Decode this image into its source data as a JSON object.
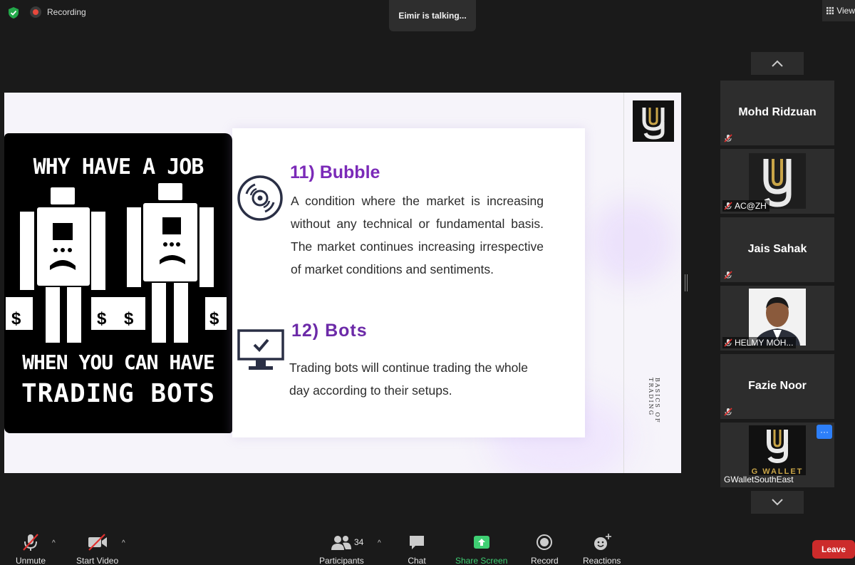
{
  "top_bar": {
    "recording_label": "Recording",
    "talking_label": "Eimir is talking...",
    "view_label": "View"
  },
  "slide": {
    "poster": {
      "line1": "WHY HAVE A JOB",
      "line2": "WHEN YOU CAN HAVE",
      "line3": "TRADING BOTS"
    },
    "item11": {
      "title": "11) Bubble",
      "body": "A condition where the market is increasing without any technical or fundamental basis. The market continues increasing irrespective of market conditions and sentiments."
    },
    "item12": {
      "title": "12) Bots",
      "body": "Trading bots will continue trading the whole day according to their setups."
    },
    "side_caption": "BASICS OF TRADING",
    "colors": {
      "heading": "#7b2ab8",
      "body": "#2b2b2b"
    }
  },
  "participants_panel": {
    "tiles": [
      {
        "name": "Mohd Ridzuan",
        "muted": true
      },
      {
        "name": "AC@ZH",
        "muted": true
      },
      {
        "name": "Jais Sahak",
        "muted": true
      },
      {
        "name": "HELMY MOH...",
        "muted": true
      },
      {
        "name": "Fazie Noor",
        "muted": true
      },
      {
        "name": "GWalletSouthEast",
        "muted": false,
        "logo_text": "G WALLET"
      }
    ],
    "more_label": "···"
  },
  "toolbar": {
    "unmute_label": "Unmute",
    "start_video_label": "Start Video",
    "participants_label": "Participants",
    "participants_count": "34",
    "chat_label": "Chat",
    "share_label": "Share Screen",
    "record_label": "Record",
    "reactions_label": "Reactions",
    "leave_label": "Leave",
    "share_color": "#3fcf73",
    "leave_color": "#cc2b2b"
  }
}
